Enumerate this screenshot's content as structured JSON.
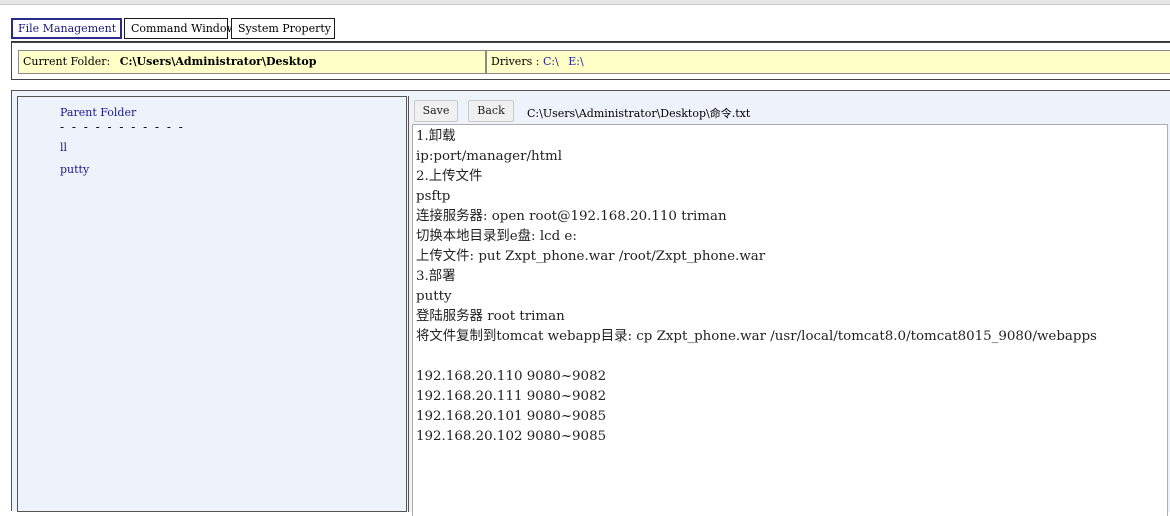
{
  "tabs": [
    {
      "label": "File Management",
      "active": true
    },
    {
      "label": "Command Window",
      "active": false
    },
    {
      "label": "System Property",
      "active": false
    }
  ],
  "pathbar": {
    "current_label": "Current Folder:",
    "current_path": "C:\\Users\\Administrator\\Desktop",
    "drivers_label": "Drivers :",
    "drives": [
      "C:\\",
      "E:\\"
    ]
  },
  "filelist": {
    "parent_label": "Parent Folder",
    "divider": "- - - - - - - - - - -",
    "items": [
      "ll",
      "putty"
    ]
  },
  "editor": {
    "save_label": "Save",
    "back_label": "Back",
    "file_path": "C:\\Users\\Administrator\\Desktop\\命令.txt",
    "lines": [
      "1.卸载",
      "ip:port/manager/html",
      "2.上传文件",
      "psftp",
      "连接服务器: open root@192.168.20.110 triman",
      "切换本地目录到e盘: lcd e:",
      "上传文件: put Zxpt_phone.war /root/Zxpt_phone.war",
      "3.部署",
      "putty",
      "登陆服务器 root triman",
      "将文件复制到tomcat webapp目录: cp Zxpt_phone.war /usr/local/tomcat8.0/tomcat8015_9080/webapps",
      "",
      "192.168.20.110 9080~9082",
      "192.168.20.111 9080~9082",
      "192.168.20.101 9080~9085",
      "192.168.20.102 9080~9085"
    ]
  },
  "colors": {
    "path_bg": "#ffffc8",
    "panel_bg": "#eef2fb",
    "link": "#1a1a8c",
    "tab_active_border": "#2b2b8a"
  }
}
